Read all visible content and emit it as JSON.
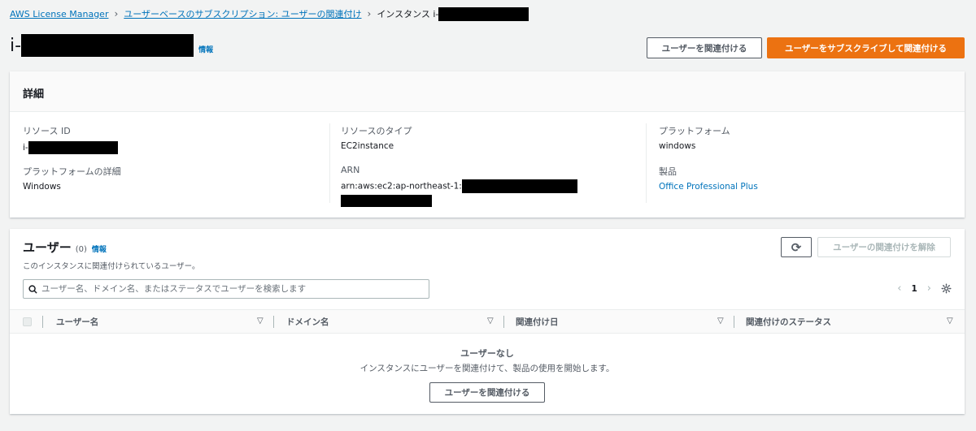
{
  "breadcrumb": {
    "items": [
      "AWS License Manager",
      "ユーザーベースのサブスクリプション: ユーザーの関連付け"
    ],
    "current": "インスタンス i-"
  },
  "header": {
    "title": "i-",
    "info": "情報",
    "associate_button": "ユーザーを関連付ける",
    "subscribe_button": "ユーザーをサブスクライブして関連付ける"
  },
  "details": {
    "title": "詳細",
    "resource_id_label": "リソース ID",
    "resource_id_value": "i-",
    "resource_type_label": "リソースのタイプ",
    "resource_type_value": "EC2instance",
    "platform_label": "プラットフォーム",
    "platform_value": "windows",
    "platform_details_label": "プラットフォームの詳細",
    "platform_details_value": "Windows",
    "arn_label": "ARN",
    "arn_value": "arn:aws:ec2:ap-northeast-1:",
    "product_label": "製品",
    "product_value": "Office Professional Plus"
  },
  "users": {
    "title": "ユーザー",
    "count": "(0)",
    "info": "情報",
    "description": "このインスタンスに関連付けられているユーザー。",
    "disassociate_button": "ユーザーの関連付けを解除",
    "search_placeholder": "ユーザー名、ドメイン名、またはステータスでユーザーを検索します",
    "page": "1",
    "columns": [
      "ユーザー名",
      "ドメイン名",
      "関連付け日",
      "関連付けのステータス"
    ],
    "empty_title": "ユーザーなし",
    "empty_desc": "インスタンスにユーザーを関連付けて、製品の使用を開始します。",
    "empty_button": "ユーザーを関連付ける"
  },
  "colors": {
    "accent": "#ec7211",
    "link": "#0073bb",
    "background": "#f2f3f3"
  }
}
